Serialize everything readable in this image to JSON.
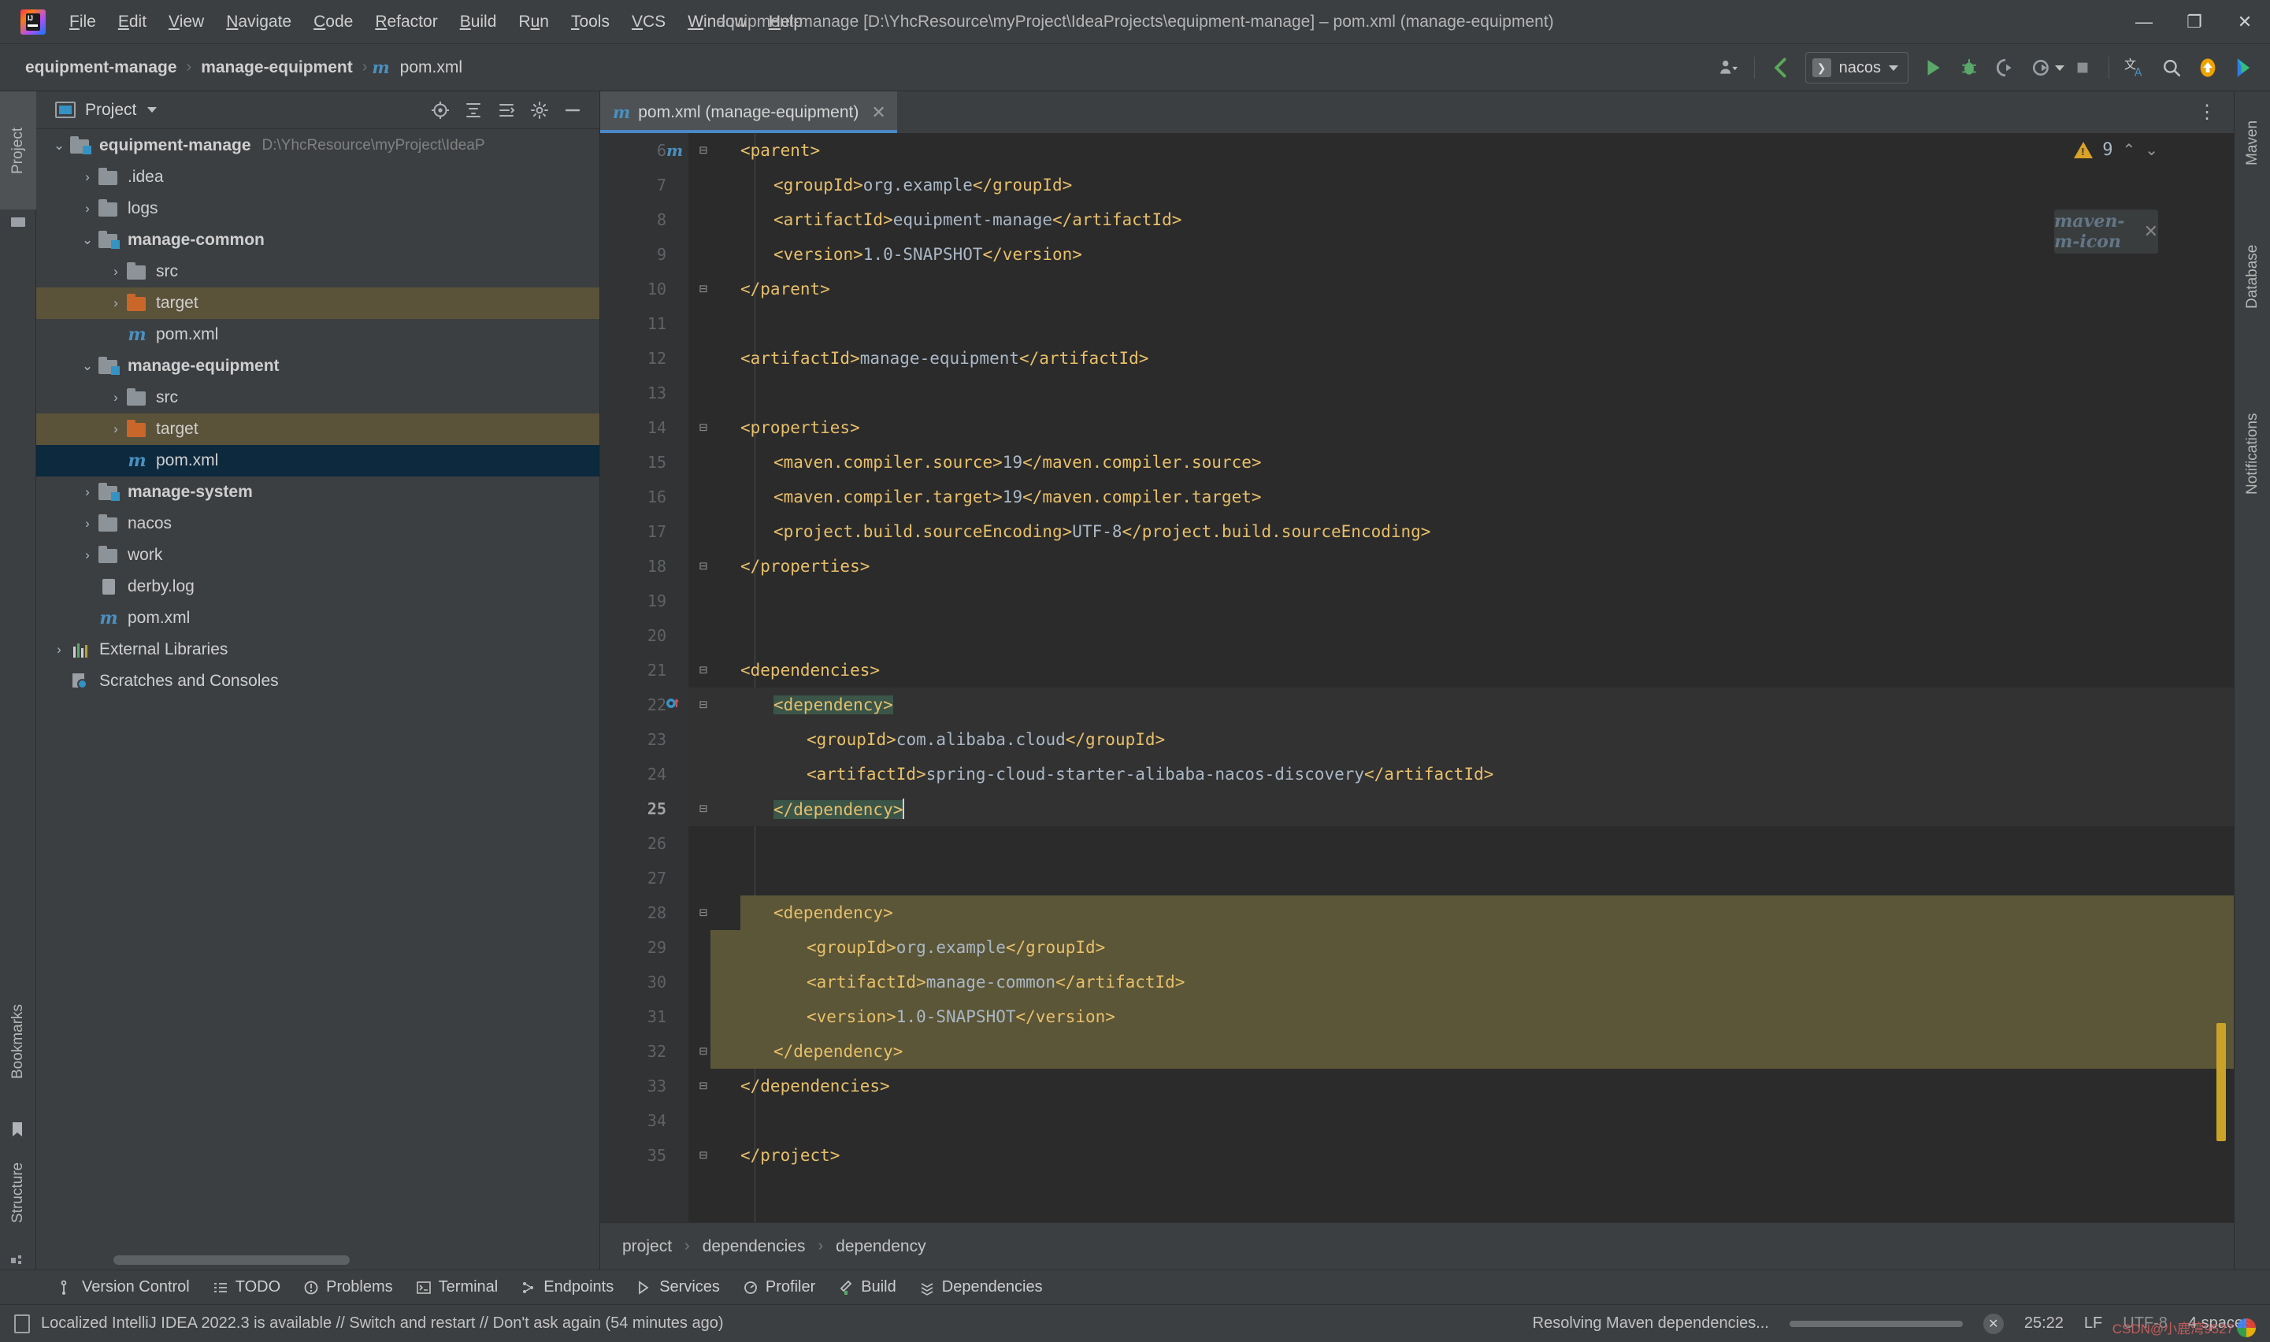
{
  "titlebar": {
    "app_logo": "intellij-idea-logo",
    "window_title": "equipment-manage [D:\\YhcResource\\myProject\\IdeaProjects\\equipment-manage] – pom.xml (manage-equipment)",
    "menus": [
      {
        "pre": "",
        "mn": "F",
        "post": "ile"
      },
      {
        "pre": "",
        "mn": "E",
        "post": "dit"
      },
      {
        "pre": "",
        "mn": "V",
        "post": "iew"
      },
      {
        "pre": "",
        "mn": "N",
        "post": "avigate"
      },
      {
        "pre": "",
        "mn": "C",
        "post": "ode"
      },
      {
        "pre": "",
        "mn": "R",
        "post": "efactor"
      },
      {
        "pre": "",
        "mn": "B",
        "post": "uild"
      },
      {
        "pre": "R",
        "mn": "u",
        "post": "n"
      },
      {
        "pre": "",
        "mn": "T",
        "post": "ools"
      },
      {
        "pre": "",
        "mn": "V",
        "post": "CS"
      },
      {
        "pre": "",
        "mn": "W",
        "post": "indow"
      },
      {
        "pre": "",
        "mn": "H",
        "post": "elp"
      }
    ],
    "window_buttons": {
      "minimize": "—",
      "maximize": "❐",
      "close": "✕"
    }
  },
  "navbar": {
    "breadcrumbs": [
      {
        "label": "equipment-manage",
        "bold": true,
        "icon": ""
      },
      {
        "label": "manage-equipment",
        "bold": true,
        "icon": ""
      },
      {
        "label": "pom.xml",
        "bold": false,
        "icon": "maven-m-icon"
      }
    ],
    "separator": "›",
    "run_config": {
      "name": "nacos",
      "chip": "❯"
    },
    "icons": {
      "account": "account-icon",
      "updates": "updates-check-icon",
      "run": "run-icon",
      "debug": "debug-icon",
      "run_coverage": "run-with-coverage-icon",
      "profile": "profile-icon",
      "stop": "stop-icon",
      "translate": "translate-icon",
      "search": "search-everywhere-icon",
      "upload": "upload-icon",
      "feedback": "ide-feature-icon"
    }
  },
  "left_strip": {
    "tabs": [
      {
        "label": "Project",
        "icon": "project-icon",
        "selected": true
      },
      {
        "label": "Bookmarks",
        "icon": "bookmarks-icon",
        "selected": false
      },
      {
        "label": "Structure",
        "icon": "structure-icon",
        "selected": false
      }
    ]
  },
  "right_strip": {
    "tabs": [
      {
        "label": "Maven",
        "icon": "maven-icon"
      },
      {
        "label": "Database",
        "icon": "database-icon"
      },
      {
        "label": "Notifications",
        "icon": "notifications-icon"
      }
    ]
  },
  "project_panel": {
    "title": "Project",
    "header_icons": [
      "scope-icon",
      "collapse-all-icon",
      "expand-icon",
      "settings-gear-icon",
      "hide-icon"
    ],
    "tree": [
      {
        "depth": 0,
        "arrow": "⌄",
        "label": "equipment-manage",
        "bold": true,
        "icon": "module-folder",
        "path": "D:\\YhcResource\\myProject\\IdeaP",
        "state": "normal"
      },
      {
        "depth": 1,
        "arrow": "›",
        "label": ".idea",
        "bold": false,
        "icon": "folder",
        "path": "",
        "state": "normal"
      },
      {
        "depth": 1,
        "arrow": "›",
        "label": "logs",
        "bold": false,
        "icon": "folder",
        "path": "",
        "state": "normal"
      },
      {
        "depth": 1,
        "arrow": "⌄",
        "label": "manage-common",
        "bold": true,
        "icon": "module-folder",
        "path": "",
        "state": "normal"
      },
      {
        "depth": 2,
        "arrow": "›",
        "label": "src",
        "bold": false,
        "icon": "folder",
        "path": "",
        "state": "normal"
      },
      {
        "depth": 2,
        "arrow": "›",
        "label": "target",
        "bold": false,
        "icon": "folder-orange",
        "path": "",
        "state": "highlight"
      },
      {
        "depth": 2,
        "arrow": "",
        "label": "pom.xml",
        "bold": false,
        "icon": "maven-file",
        "path": "",
        "state": "normal"
      },
      {
        "depth": 1,
        "arrow": "⌄",
        "label": "manage-equipment",
        "bold": true,
        "icon": "module-folder",
        "path": "",
        "state": "normal"
      },
      {
        "depth": 2,
        "arrow": "›",
        "label": "src",
        "bold": false,
        "icon": "folder",
        "path": "",
        "state": "normal"
      },
      {
        "depth": 2,
        "arrow": "›",
        "label": "target",
        "bold": false,
        "icon": "folder-orange",
        "path": "",
        "state": "highlight"
      },
      {
        "depth": 2,
        "arrow": "",
        "label": "pom.xml",
        "bold": false,
        "icon": "maven-file",
        "path": "",
        "state": "selected"
      },
      {
        "depth": 1,
        "arrow": "›",
        "label": "manage-system",
        "bold": true,
        "icon": "module-folder",
        "path": "",
        "state": "normal"
      },
      {
        "depth": 1,
        "arrow": "›",
        "label": "nacos",
        "bold": false,
        "icon": "folder",
        "path": "",
        "state": "normal"
      },
      {
        "depth": 1,
        "arrow": "›",
        "label": "work",
        "bold": false,
        "icon": "folder",
        "path": "",
        "state": "normal"
      },
      {
        "depth": 1,
        "arrow": "",
        "label": "derby.log",
        "bold": false,
        "icon": "log-file",
        "path": "",
        "state": "normal"
      },
      {
        "depth": 1,
        "arrow": "",
        "label": "pom.xml",
        "bold": false,
        "icon": "maven-file",
        "path": "",
        "state": "normal"
      },
      {
        "depth": 0,
        "arrow": "›",
        "label": "External Libraries",
        "bold": false,
        "icon": "libraries",
        "path": "",
        "state": "normal"
      },
      {
        "depth": 0,
        "arrow": "",
        "label": "Scratches and Consoles",
        "bold": false,
        "icon": "scratches",
        "path": "",
        "state": "normal"
      }
    ]
  },
  "editor": {
    "tab": {
      "title": "pom.xml (manage-equipment)",
      "icon": "maven-m-icon",
      "close": "✕"
    },
    "warnings": {
      "count": "9",
      "icon": "warning-triangle-icon",
      "up": "⌃",
      "down": "⌄"
    },
    "inspector_widget": {
      "icon": "maven-m-icon",
      "close": "✕"
    },
    "lines": [
      {
        "num": "6",
        "fold": "⊟",
        "indent": 0,
        "segments": [
          {
            "t": "tag",
            "s": "<parent>"
          }
        ]
      },
      {
        "num": "7",
        "fold": "",
        "indent": 1,
        "segments": [
          {
            "t": "tag",
            "s": "<groupId>"
          },
          {
            "t": "val",
            "s": "org.example"
          },
          {
            "t": "tag",
            "s": "</groupId>"
          }
        ]
      },
      {
        "num": "8",
        "fold": "",
        "indent": 1,
        "segments": [
          {
            "t": "tag",
            "s": "<artifactId>"
          },
          {
            "t": "val",
            "s": "equipment-manage"
          },
          {
            "t": "tag",
            "s": "</artifactId>"
          }
        ]
      },
      {
        "num": "9",
        "fold": "",
        "indent": 1,
        "segments": [
          {
            "t": "tag",
            "s": "<version>"
          },
          {
            "t": "val",
            "s": "1.0-SNAPSHOT"
          },
          {
            "t": "tag",
            "s": "</version>"
          }
        ]
      },
      {
        "num": "10",
        "fold": "⊟",
        "indent": 0,
        "segments": [
          {
            "t": "tag",
            "s": "</parent>"
          }
        ]
      },
      {
        "num": "11",
        "fold": "",
        "indent": 0,
        "segments": []
      },
      {
        "num": "12",
        "fold": "",
        "indent": 0,
        "segments": [
          {
            "t": "tag",
            "s": "<artifactId>"
          },
          {
            "t": "val",
            "s": "manage-equipment"
          },
          {
            "t": "tag",
            "s": "</artifactId>"
          }
        ]
      },
      {
        "num": "13",
        "fold": "",
        "indent": 0,
        "segments": []
      },
      {
        "num": "14",
        "fold": "⊟",
        "indent": 0,
        "segments": [
          {
            "t": "tag",
            "s": "<properties>"
          }
        ]
      },
      {
        "num": "15",
        "fold": "",
        "indent": 1,
        "segments": [
          {
            "t": "tag",
            "s": "<maven.compiler.source>"
          },
          {
            "t": "val",
            "s": "19"
          },
          {
            "t": "tag",
            "s": "</maven.compiler.source>"
          }
        ]
      },
      {
        "num": "16",
        "fold": "",
        "indent": 1,
        "segments": [
          {
            "t": "tag",
            "s": "<maven.compiler.target>"
          },
          {
            "t": "val",
            "s": "19"
          },
          {
            "t": "tag",
            "s": "</maven.compiler.target>"
          }
        ]
      },
      {
        "num": "17",
        "fold": "",
        "indent": 1,
        "segments": [
          {
            "t": "tag",
            "s": "<project.build.sourceEncoding>"
          },
          {
            "t": "val",
            "s": "UTF-8"
          },
          {
            "t": "tag",
            "s": "</project.build.sourceEncoding>"
          }
        ]
      },
      {
        "num": "18",
        "fold": "⊟",
        "indent": 0,
        "segments": [
          {
            "t": "tag",
            "s": "</properties>"
          }
        ]
      },
      {
        "num": "19",
        "fold": "",
        "indent": 0,
        "segments": []
      },
      {
        "num": "20",
        "fold": "",
        "indent": 0,
        "segments": []
      },
      {
        "num": "21",
        "fold": "⊟",
        "indent": 0,
        "segments": [
          {
            "t": "tag",
            "s": "<dependencies>"
          }
        ]
      },
      {
        "num": "22",
        "fold": "⊟",
        "indent": 1,
        "segments": [
          {
            "t": "tag pair",
            "s": "<dependency>"
          }
        ]
      },
      {
        "num": "23",
        "fold": "",
        "indent": 2,
        "segments": [
          {
            "t": "tag",
            "s": "<groupId>"
          },
          {
            "t": "val",
            "s": "com.alibaba.cloud"
          },
          {
            "t": "tag",
            "s": "</groupId>"
          }
        ]
      },
      {
        "num": "24",
        "fold": "",
        "indent": 2,
        "segments": [
          {
            "t": "tag",
            "s": "<artifactId>"
          },
          {
            "t": "val",
            "s": "spring-cloud-starter-alibaba-nacos-discovery"
          },
          {
            "t": "tag",
            "s": "</artifactId>"
          }
        ]
      },
      {
        "num": "25",
        "fold": "⊟",
        "indent": 1,
        "segments": [
          {
            "t": "tag pair",
            "s": "</dependency>"
          },
          {
            "t": "caret",
            "s": ""
          }
        ]
      },
      {
        "num": "26",
        "fold": "",
        "indent": 0,
        "segments": []
      },
      {
        "num": "27",
        "fold": "",
        "indent": 0,
        "segments": []
      },
      {
        "num": "28",
        "fold": "⊟",
        "indent": 1,
        "segments": [
          {
            "t": "tag",
            "s": "<dependency>"
          }
        ]
      },
      {
        "num": "29",
        "fold": "",
        "indent": 2,
        "segments": [
          {
            "t": "tag",
            "s": "<groupId>"
          },
          {
            "t": "val",
            "s": "org.example"
          },
          {
            "t": "tag",
            "s": "</groupId>"
          }
        ]
      },
      {
        "num": "30",
        "fold": "",
        "indent": 2,
        "segments": [
          {
            "t": "tag",
            "s": "<artifactId>"
          },
          {
            "t": "val",
            "s": "manage-common"
          },
          {
            "t": "tag",
            "s": "</artifactId>"
          }
        ]
      },
      {
        "num": "31",
        "fold": "",
        "indent": 2,
        "segments": [
          {
            "t": "tag",
            "s": "<version>"
          },
          {
            "t": "val",
            "s": "1.0-SNAPSHOT"
          },
          {
            "t": "tag",
            "s": "</version>"
          }
        ]
      },
      {
        "num": "32",
        "fold": "⊟",
        "indent": 1,
        "segments": [
          {
            "t": "tag",
            "s": "</dependency>"
          }
        ]
      },
      {
        "num": "33",
        "fold": "⊟",
        "indent": 0,
        "segments": [
          {
            "t": "tag",
            "s": "</dependencies>"
          }
        ]
      },
      {
        "num": "34",
        "fold": "",
        "indent": 0,
        "segments": []
      },
      {
        "num": "35",
        "fold": "⊟",
        "indent": -1,
        "segments": [
          {
            "t": "tag",
            "s": "</project>"
          }
        ]
      }
    ],
    "current_line": "25",
    "breadcrumbs": [
      "project",
      "dependencies",
      "dependency"
    ],
    "breadcrumb_sep": "›"
  },
  "tool_windows": [
    {
      "label": "Version Control",
      "icon": "branch-icon"
    },
    {
      "label": "TODO",
      "icon": "list-icon"
    },
    {
      "label": "Problems",
      "icon": "problems-icon"
    },
    {
      "label": "Terminal",
      "icon": "terminal-icon"
    },
    {
      "label": "Endpoints",
      "icon": "endpoints-icon"
    },
    {
      "label": "Services",
      "icon": "services-icon"
    },
    {
      "label": "Profiler",
      "icon": "profiler-icon"
    },
    {
      "label": "Build",
      "icon": "build-hammer-icon"
    },
    {
      "label": "Dependencies",
      "icon": "dependencies-icon"
    }
  ],
  "statusbar": {
    "notification_icon": "notification-doc-icon",
    "message": "Localized IntelliJ IDEA 2022.3 is available // Switch and restart // Don't ask again (54 minutes ago)",
    "progress_text": "Resolving Maven dependencies...",
    "progress_cancel": "✕",
    "caret_position": "25:22",
    "line_separator": "LF",
    "encoding": "UTF-8",
    "indent": "4 spaces",
    "watermark": "CSDN@小鹿湾9527"
  },
  "colors": {
    "background": "#3c3f41",
    "editor_bg": "#2b2b2b",
    "accent_blue": "#3592c4",
    "tag_orange": "#e8bf6a",
    "value_gray": "#a9b7c6",
    "selection_navy": "#0d293e",
    "highlight_olive": "#5b5637",
    "pair_teal": "#3b5549",
    "warning_yellow": "#d9a227",
    "folder_orange": "#c9662a"
  }
}
